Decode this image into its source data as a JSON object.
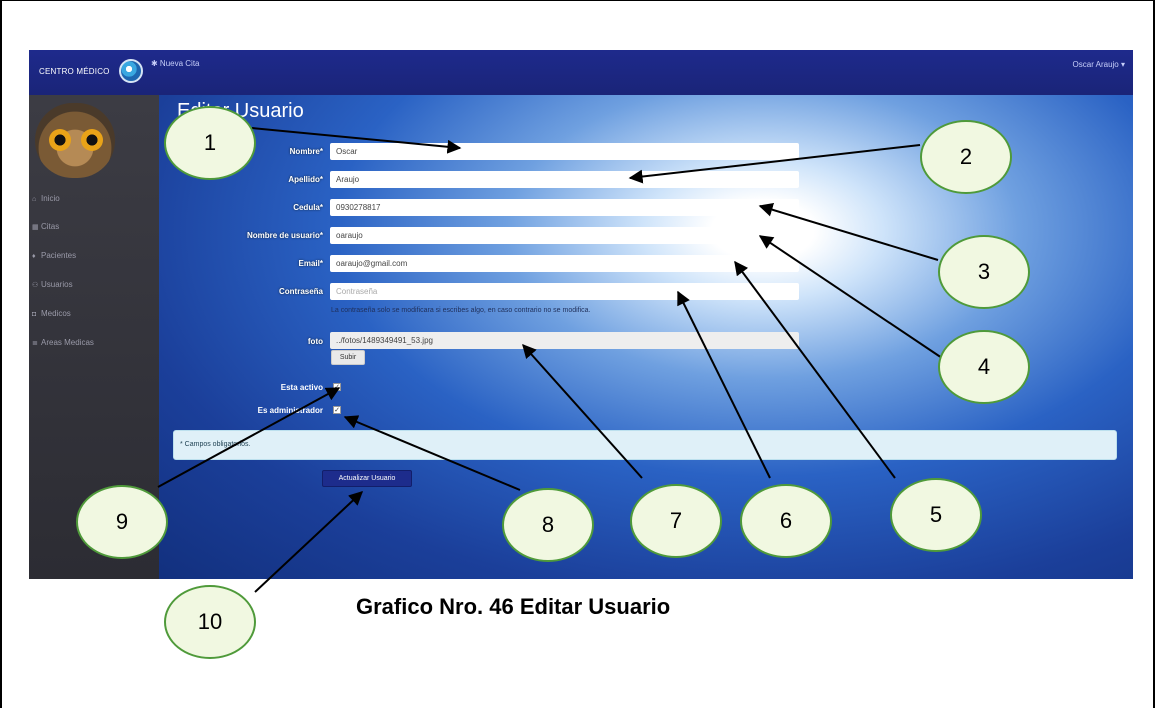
{
  "app": {
    "brand": "CENTRO MÉDICO",
    "nav_new": "✱ Nueva Cita",
    "user_menu": "Oscar Araujo ▾"
  },
  "sidebar": {
    "items": [
      {
        "icon": "home-icon",
        "glyph": "⌂",
        "label": "Inicio"
      },
      {
        "icon": "calendar-icon",
        "glyph": "▦",
        "label": "Citas"
      },
      {
        "icon": "user-icon",
        "glyph": "♦",
        "label": "Pacientes"
      },
      {
        "icon": "users-icon",
        "glyph": "⚇",
        "label": "Usuarios"
      },
      {
        "icon": "doctor-icon",
        "glyph": "◘",
        "label": "Medicos"
      },
      {
        "icon": "list-icon",
        "glyph": "≣",
        "label": "Areas Medicas"
      }
    ]
  },
  "form": {
    "title": "Editar Usuario",
    "fields": [
      {
        "label": "Nombre*",
        "value": "Oscar"
      },
      {
        "label": "Apellido*",
        "value": "Araujo"
      },
      {
        "label": "Cedula*",
        "value": "0930278817"
      },
      {
        "label": "Nombre de usuario*",
        "value": "oaraujo"
      },
      {
        "label": "Email*",
        "value": "oaraujo@gmail.com"
      },
      {
        "label": "Contraseña",
        "placeholder": "Contraseña"
      }
    ],
    "password_help": "La contraseña solo se modificara si escribes algo, en caso contrario no se modifica.",
    "foto_label": "foto",
    "foto_value": "../fotos/1489349491_53.jpg",
    "upload_label": "Subir",
    "active_label": "Esta activo",
    "admin_label": "Es administrador",
    "required_note": "* Campos obligatorios.",
    "submit_label": "Actualizar Usuario"
  },
  "callouts": [
    "1",
    "2",
    "3",
    "4",
    "5",
    "6",
    "7",
    "8",
    "9",
    "10"
  ],
  "caption": "Grafico Nro. 46 Editar Usuario",
  "colors": {
    "navbar": "#1e2a8c",
    "sidebar": "#34343b",
    "primary_button": "#1d2c8c",
    "callout_border": "#4f9a3a",
    "callout_fill": "#f1f8e1"
  }
}
